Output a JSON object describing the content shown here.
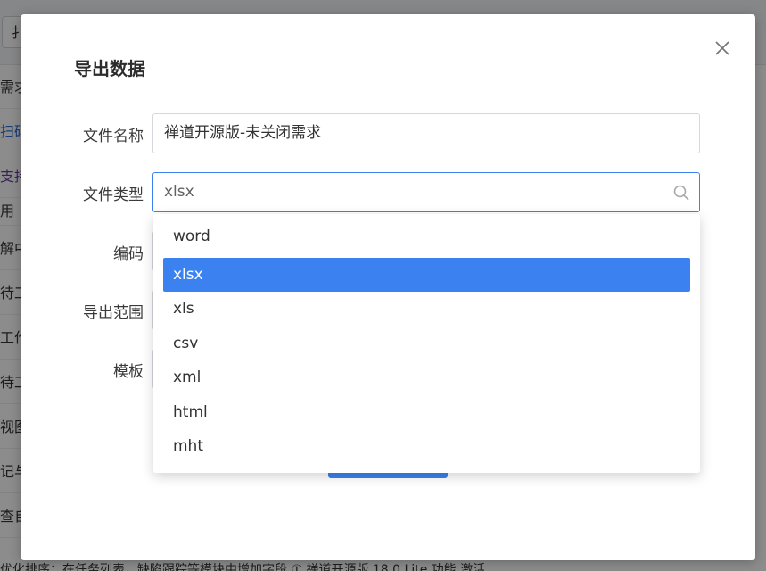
{
  "background": {
    "top_button_label": "扌",
    "side_rows": [
      "需求",
      "扫码",
      "支持",
      "用",
      "解中",
      "待工",
      "工作",
      "待工",
      "视图",
      "记与",
      "查自"
    ],
    "bottom_text": "优化排序：在任务列表，缺陷跟踪等模块中增加字段 ① 禅道开源版 18.0 Lite 功能 激活"
  },
  "modal": {
    "title": "导出数据",
    "close_icon": "close-icon",
    "fields": {
      "file_name": {
        "label": "文件名称",
        "value": "禅道开源版-未关闭需求"
      },
      "file_type": {
        "label": "文件类型",
        "value": "xlsx",
        "icon": "search-icon"
      },
      "encoding": {
        "label": "编码"
      },
      "export_range": {
        "label": "导出范围"
      },
      "template": {
        "label": "模板"
      }
    }
  },
  "dropdown": {
    "options": [
      "word",
      "xlsx",
      "xls",
      "csv",
      "xml",
      "html",
      "mht"
    ],
    "selected": "xlsx"
  },
  "colors": {
    "accent": "#3b82f0",
    "overlay": "rgba(0,0,0,0.45)"
  }
}
